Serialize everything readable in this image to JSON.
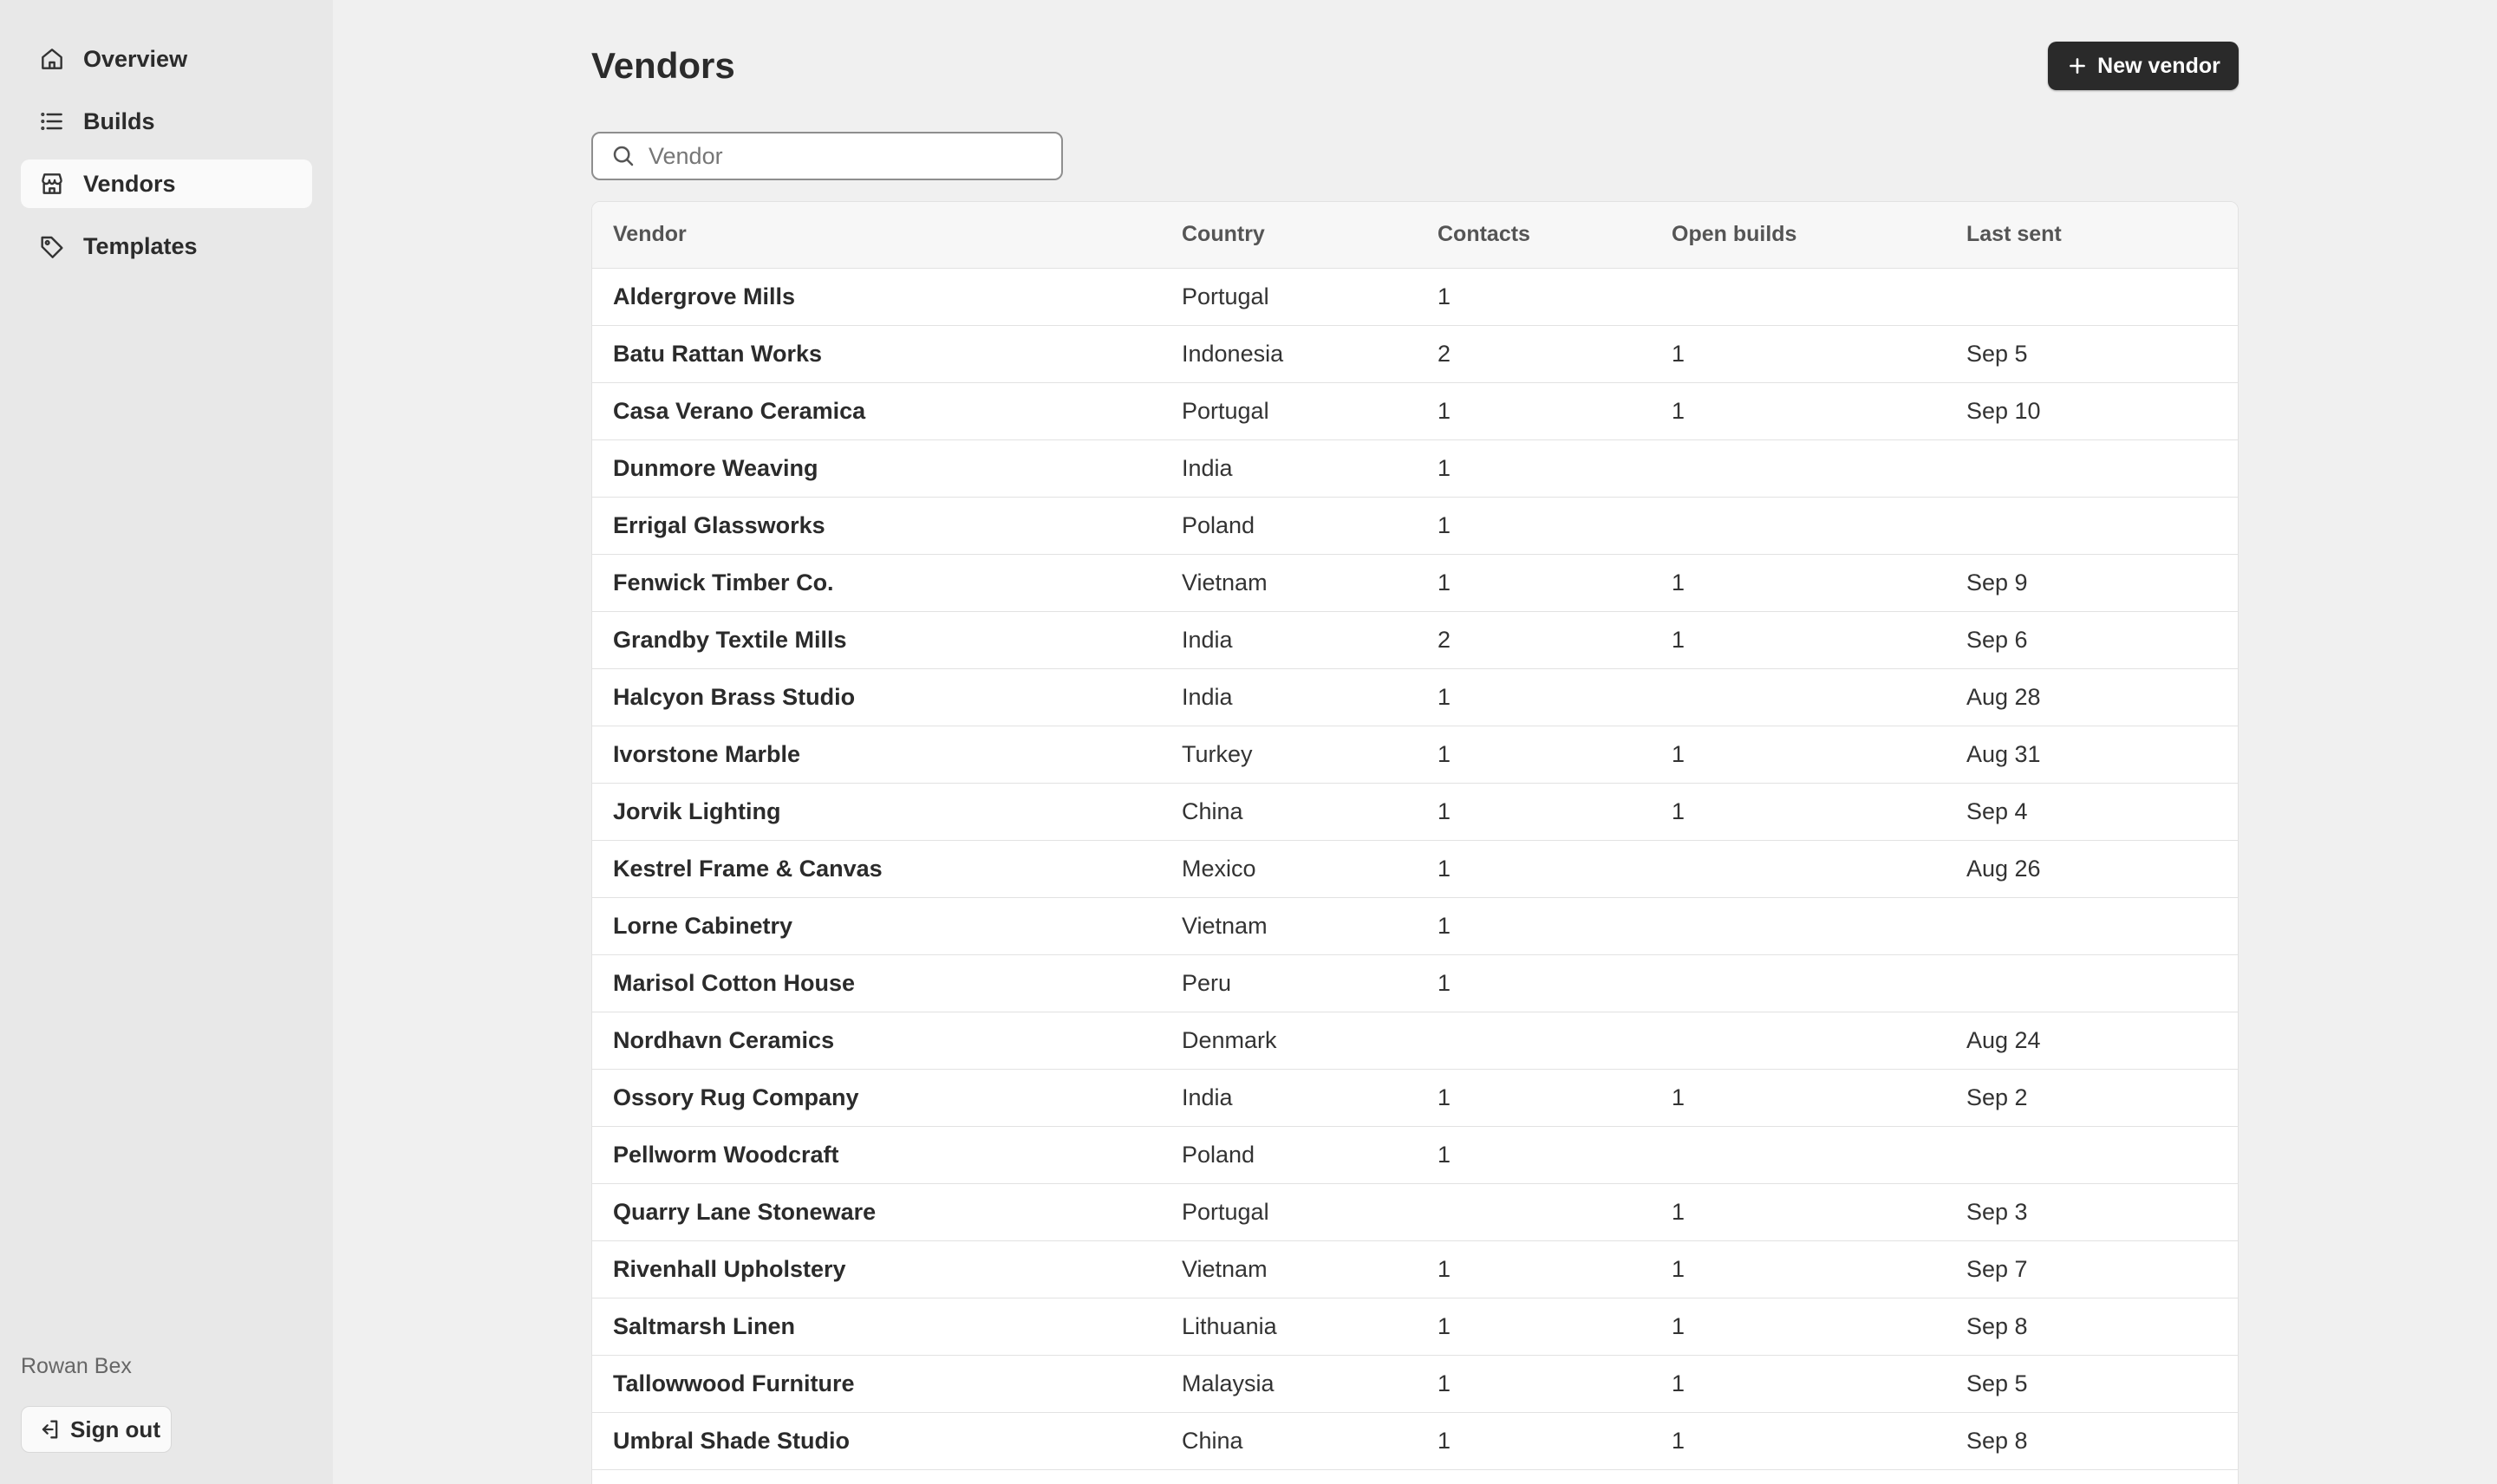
{
  "sidebar": {
    "items": [
      {
        "label": "Overview",
        "icon": "home-icon",
        "active": false
      },
      {
        "label": "Builds",
        "icon": "list-icon",
        "active": false
      },
      {
        "label": "Vendors",
        "icon": "store-icon",
        "active": true
      },
      {
        "label": "Templates",
        "icon": "tag-icon",
        "active": false
      }
    ],
    "user_name": "Rowan Bex",
    "sign_out_label": "Sign out"
  },
  "main": {
    "title": "Vendors",
    "new_button_label": "New vendor",
    "search": {
      "placeholder": "Vendor",
      "value": ""
    },
    "table": {
      "columns": [
        "Vendor",
        "Country",
        "Contacts",
        "Open builds",
        "Last sent"
      ],
      "rows": [
        [
          "Aldergrove Mills",
          "Portugal",
          "1",
          "",
          ""
        ],
        [
          "Batu Rattan Works",
          "Indonesia",
          "2",
          "1",
          "Sep 5"
        ],
        [
          "Casa Verano Ceramica",
          "Portugal",
          "1",
          "1",
          "Sep 10"
        ],
        [
          "Dunmore Weaving",
          "India",
          "1",
          "",
          ""
        ],
        [
          "Errigal Glassworks",
          "Poland",
          "1",
          "",
          ""
        ],
        [
          "Fenwick Timber Co.",
          "Vietnam",
          "1",
          "1",
          "Sep 9"
        ],
        [
          "Grandby Textile Mills",
          "India",
          "2",
          "1",
          "Sep 6"
        ],
        [
          "Halcyon Brass Studio",
          "India",
          "1",
          "",
          "Aug 28"
        ],
        [
          "Ivorstone Marble",
          "Turkey",
          "1",
          "1",
          "Aug 31"
        ],
        [
          "Jorvik Lighting",
          "China",
          "1",
          "1",
          "Sep 4"
        ],
        [
          "Kestrel Frame & Canvas",
          "Mexico",
          "1",
          "",
          "Aug 26"
        ],
        [
          "Lorne Cabinetry",
          "Vietnam",
          "1",
          "",
          ""
        ],
        [
          "Marisol Cotton House",
          "Peru",
          "1",
          "",
          ""
        ],
        [
          "Nordhavn Ceramics",
          "Denmark",
          "",
          "",
          "Aug 24"
        ],
        [
          "Ossory Rug Company",
          "India",
          "1",
          "1",
          "Sep 2"
        ],
        [
          "Pellworm Woodcraft",
          "Poland",
          "1",
          "",
          ""
        ],
        [
          "Quarry Lane Stoneware",
          "Portugal",
          "",
          "1",
          "Sep 3"
        ],
        [
          "Rivenhall Upholstery",
          "Vietnam",
          "1",
          "1",
          "Sep 7"
        ],
        [
          "Saltmarsh Linen",
          "Lithuania",
          "1",
          "1",
          "Sep 8"
        ],
        [
          "Tallowwood Furniture",
          "Malaysia",
          "1",
          "1",
          "Sep 5"
        ],
        [
          "Umbral Shade Studio",
          "China",
          "1",
          "1",
          "Sep 8"
        ],
        [
          "",
          "",
          "",
          "",
          ""
        ]
      ]
    }
  }
}
